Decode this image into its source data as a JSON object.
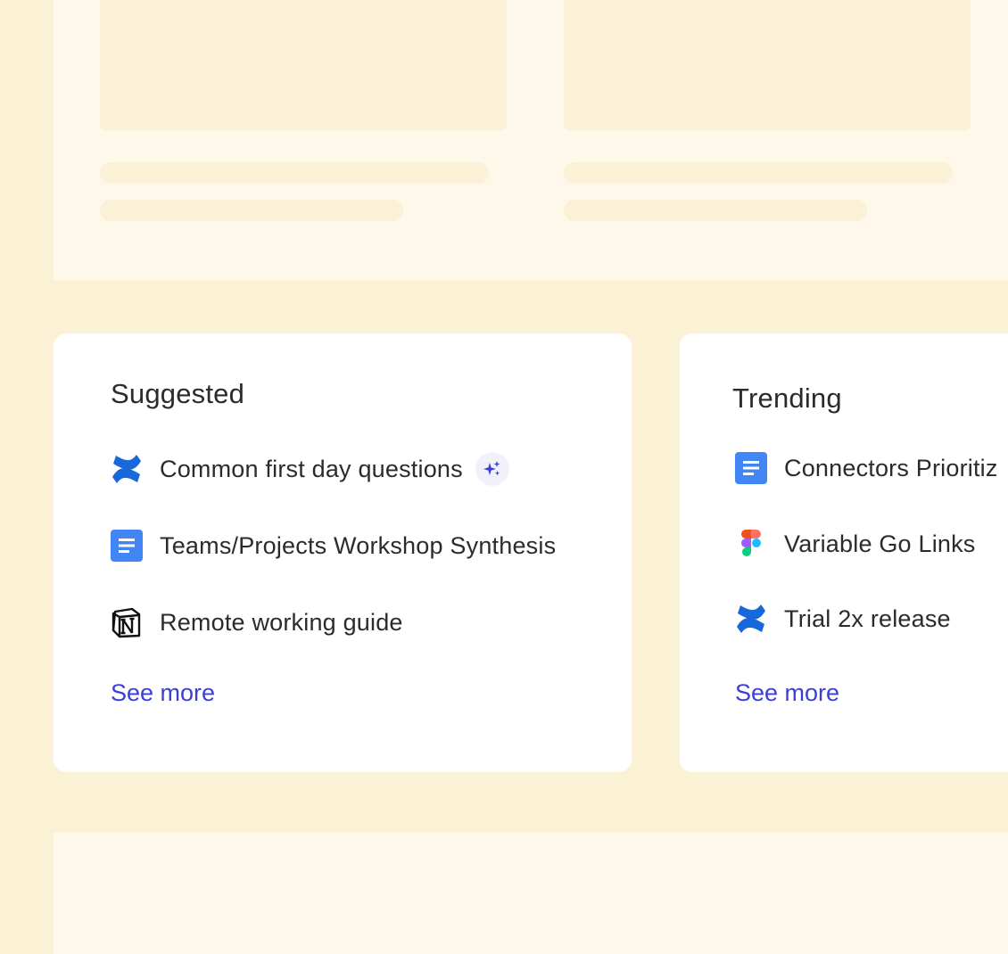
{
  "suggested": {
    "title": "Suggested",
    "items": [
      {
        "label": "Common first day questions",
        "icon": "confluence-icon",
        "ai_badge": "sparkle-icon"
      },
      {
        "label": "Teams/Projects Workshop Synthesis",
        "icon": "google-docs-icon"
      },
      {
        "label": "Remote working guide",
        "icon": "notion-icon"
      }
    ],
    "see_more": "See more"
  },
  "trending": {
    "title": "Trending",
    "items": [
      {
        "label": "Connectors Prioritiz",
        "icon": "google-docs-icon"
      },
      {
        "label": "Variable Go Links",
        "icon": "figma-icon"
      },
      {
        "label": "Trial 2x release",
        "icon": "confluence-icon"
      }
    ],
    "see_more": "See more"
  },
  "colors": {
    "background": "#FBF2D6",
    "panel": "#FDF8EA",
    "placeholder": "#FBF1D6",
    "card": "#FFFFFF",
    "text": "#2B2B2B",
    "link": "#3A3FD8",
    "confluence_blue": "#1868DB",
    "docs_blue": "#4285F4"
  }
}
